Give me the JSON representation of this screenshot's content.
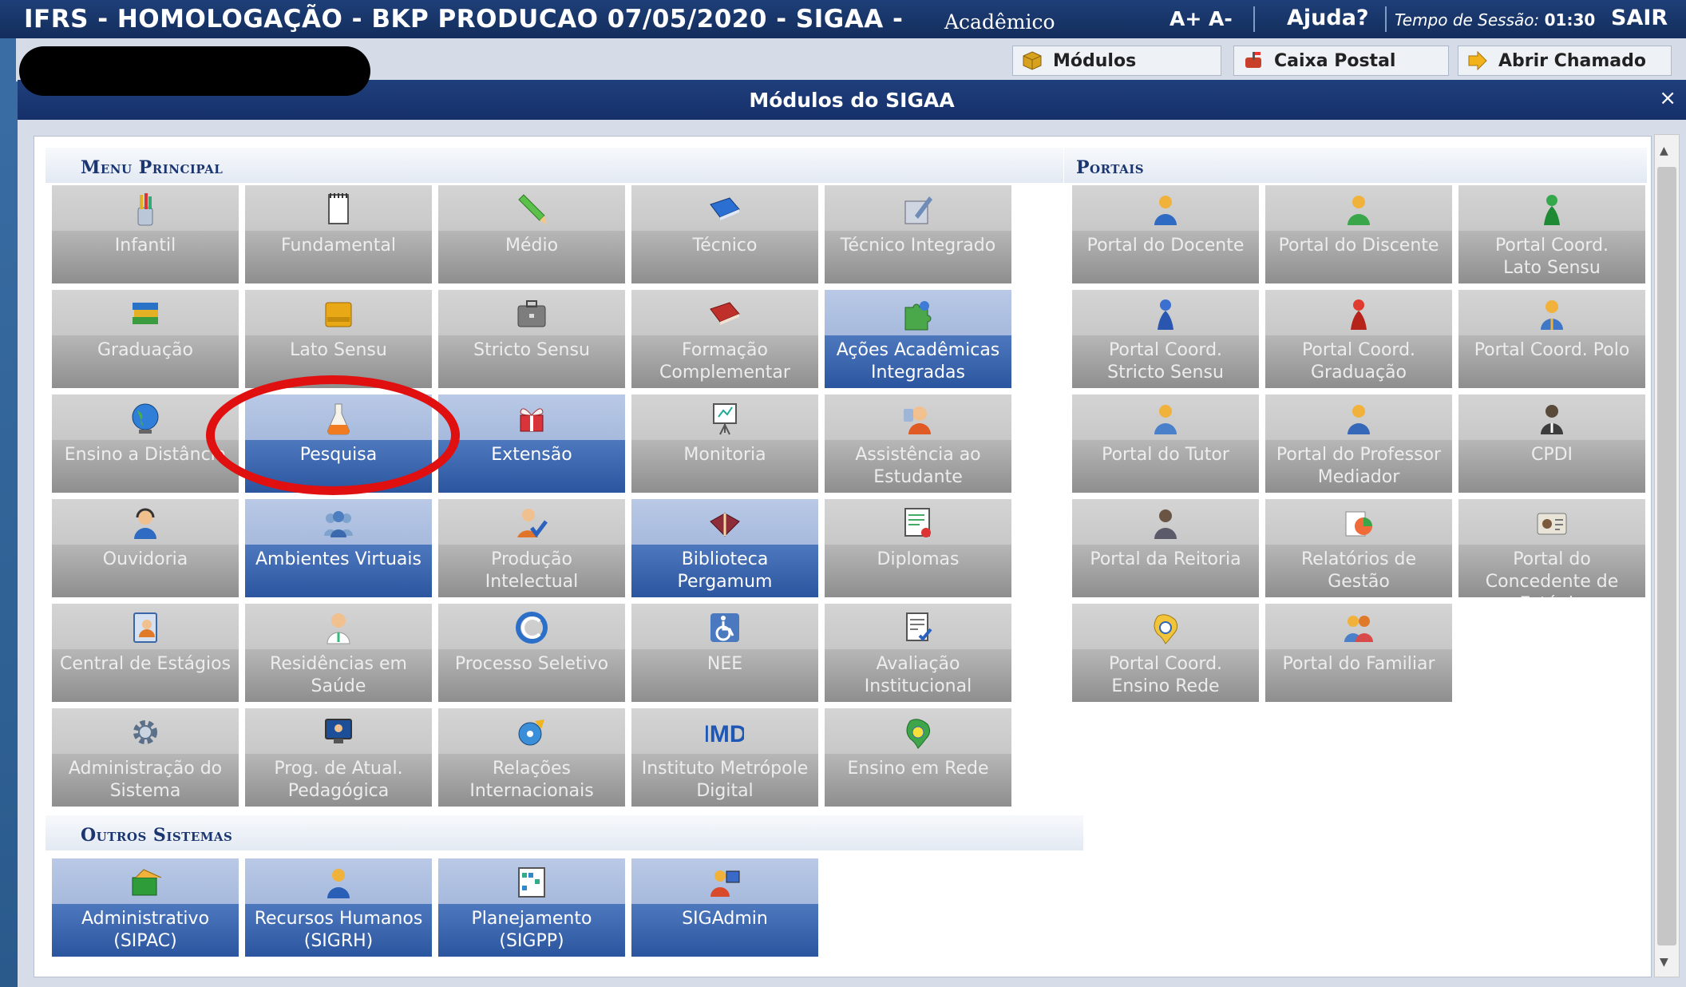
{
  "topbar": {
    "system": "IFRS - HOMOLOGAÇÃO - BKP PRODUCAO 07/05/2020 - SIGAA -",
    "subtitle": "Acadêmico",
    "font_controls": "A+ A-",
    "help": "Ajuda?",
    "session_label": "Tempo de Sessão:",
    "session_time": "01:30",
    "logout": "SAIR"
  },
  "toolbar": {
    "modules": "Módulos",
    "mailbox": "Caixa Postal",
    "ticket": "Abrir Chamado"
  },
  "dialog": {
    "title": "Módulos do SIGAA",
    "close": "×"
  },
  "sections": {
    "main": "Menu Principal",
    "portals": "Portais",
    "others": "Outros Sistemas"
  },
  "main_modules": [
    {
      "label": "Infantil",
      "style": "gray",
      "icon": "pencil-cup-icon"
    },
    {
      "label": "Fundamental",
      "style": "gray",
      "icon": "notebook-icon"
    },
    {
      "label": "Médio",
      "style": "gray",
      "icon": "pencil-icon"
    },
    {
      "label": "Técnico",
      "style": "gray",
      "icon": "blue-book-icon"
    },
    {
      "label": "Técnico Integrado",
      "style": "gray",
      "icon": "edit-document-icon"
    },
    {
      "label": "Graduação",
      "style": "gray",
      "icon": "books-stack-icon"
    },
    {
      "label": "Lato Sensu",
      "style": "gray",
      "icon": "folder-icon"
    },
    {
      "label": "Stricto Sensu",
      "style": "gray",
      "icon": "briefcase-icon"
    },
    {
      "label": "Formação\nComplementar",
      "style": "gray",
      "icon": "red-book-icon"
    },
    {
      "label": "Ações Acadêmicas\nIntegradas",
      "style": "blue",
      "icon": "puzzle-icon"
    },
    {
      "label": "Ensino a Distância",
      "style": "gray",
      "icon": "globe-icon"
    },
    {
      "label": "Pesquisa",
      "style": "blue",
      "icon": "flask-icon"
    },
    {
      "label": "Extensão",
      "style": "blue",
      "icon": "gift-icon"
    },
    {
      "label": "Monitoria",
      "style": "gray",
      "icon": "presentation-board-icon"
    },
    {
      "label": "Assistência ao\nEstudante",
      "style": "gray",
      "icon": "support-person-icon"
    },
    {
      "label": "Ouvidoria",
      "style": "gray",
      "icon": "headset-person-icon"
    },
    {
      "label": "Ambientes Virtuais",
      "style": "blue",
      "icon": "people-group-icon"
    },
    {
      "label": "Produção\nIntelectual",
      "style": "gray",
      "icon": "person-check-icon"
    },
    {
      "label": "Biblioteca\nPergamum",
      "style": "blue",
      "icon": "open-book-icon"
    },
    {
      "label": "Diplomas",
      "style": "gray",
      "icon": "certificate-icon"
    },
    {
      "label": "Central de Estágios",
      "style": "gray",
      "icon": "address-book-icon"
    },
    {
      "label": "Residências em\nSaúde",
      "style": "gray",
      "icon": "doctor-icon"
    },
    {
      "label": "Processo Seletivo",
      "style": "gray",
      "icon": "c-swirl-icon"
    },
    {
      "label": "NEE",
      "style": "gray",
      "icon": "wheelchair-icon"
    },
    {
      "label": "Avaliação\nInstitucional",
      "style": "gray",
      "icon": "evaluation-form-icon"
    },
    {
      "label": "Administração do\nSistema",
      "style": "gray",
      "icon": "gear-icon"
    },
    {
      "label": "Prog. de Atual.\nPedagógica",
      "style": "gray",
      "icon": "monitor-icon"
    },
    {
      "label": "Relações\nInternacionais",
      "style": "gray",
      "icon": "globe-cd-icon"
    },
    {
      "label": "Instituto Metrópole\nDigital",
      "style": "gray",
      "icon": "imd-logo-icon",
      "icon_text": "IMD"
    },
    {
      "label": "Ensino em Rede",
      "style": "gray",
      "icon": "network-brazil-icon"
    }
  ],
  "portals": [
    {
      "label": "Portal do Docente",
      "style": "gray",
      "icon": "teacher-icon"
    },
    {
      "label": "Portal do Discente",
      "style": "gray",
      "icon": "student-icon"
    },
    {
      "label": "Portal Coord.\nLato Sensu",
      "style": "gray",
      "icon": "green-pawn-icon"
    },
    {
      "label": "Portal Coord.\nStricto Sensu",
      "style": "gray",
      "icon": "blue-pawn-icon"
    },
    {
      "label": "Portal Coord.\nGraduação",
      "style": "gray",
      "icon": "red-pawn-icon"
    },
    {
      "label": "Portal Coord. Polo",
      "style": "gray",
      "icon": "coordinator-icon"
    },
    {
      "label": "Portal do Tutor",
      "style": "gray",
      "icon": "tutor-icon"
    },
    {
      "label": "Portal do Professor\nMediador",
      "style": "gray",
      "icon": "professor-icon"
    },
    {
      "label": "CPDI",
      "style": "gray",
      "icon": "manager-icon"
    },
    {
      "label": "Portal da Reitoria",
      "style": "gray",
      "icon": "rector-icon"
    },
    {
      "label": "Relatórios de\nGestão",
      "style": "gray",
      "icon": "reports-icon"
    },
    {
      "label": "Portal do\nConcedente de\nEstágio",
      "style": "gray",
      "icon": "id-card-icon"
    },
    {
      "label": "Portal Coord.\nEnsino Rede",
      "style": "gray",
      "icon": "network-icon"
    },
    {
      "label": "Portal do Familiar",
      "style": "gray",
      "icon": "family-icon"
    }
  ],
  "other_systems": [
    {
      "label": "Administrativo\n(SIPAC)",
      "style": "blue",
      "icon": "administrative-icon"
    },
    {
      "label": "Recursos Humanos\n(SIGRH)",
      "style": "blue",
      "icon": "hr-person-icon"
    },
    {
      "label": "Planejamento\n(SIGPP)",
      "style": "blue",
      "icon": "planning-chart-icon"
    },
    {
      "label": "SIGAdmin",
      "style": "blue",
      "icon": "admin-computer-icon"
    }
  ],
  "colors": {
    "title_bar": "#1f3f7c",
    "tile_gray": "#8e8e8e",
    "tile_blue": "#2b559e",
    "highlight_circle": "#e01010"
  }
}
